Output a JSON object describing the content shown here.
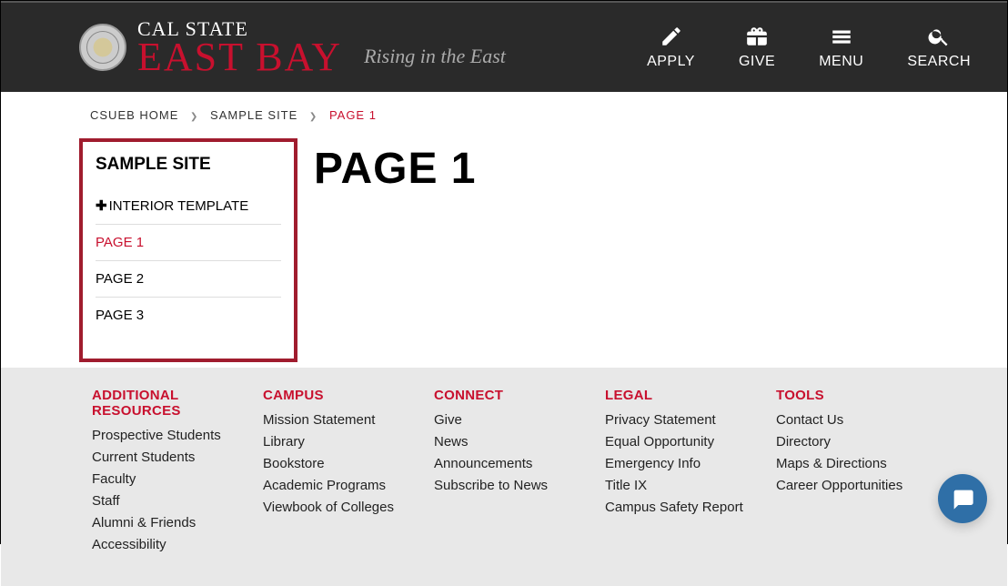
{
  "brand": {
    "top": "CAL STATE",
    "main": "EAST BAY",
    "tagline": "Rising in the East"
  },
  "headerNav": {
    "apply": "APPLY",
    "give": "GIVE",
    "menu": "MENU",
    "search": "SEARCH"
  },
  "breadcrumb": {
    "home": "CSUEB HOME",
    "site": "SAMPLE SITE",
    "current": "PAGE 1"
  },
  "sidebar": {
    "title": "SAMPLE SITE",
    "items": [
      {
        "label": "INTERIOR TEMPLATE",
        "expandable": true
      },
      {
        "label": "PAGE 1",
        "active": true
      },
      {
        "label": "PAGE 2"
      },
      {
        "label": "PAGE 3"
      }
    ]
  },
  "page": {
    "title": "PAGE 1"
  },
  "footer": {
    "cols": [
      {
        "title": "ADDITIONAL RESOURCES",
        "links": [
          "Prospective Students",
          "Current Students",
          "Faculty",
          "Staff",
          "Alumni & Friends",
          "Accessibility"
        ]
      },
      {
        "title": "CAMPUS",
        "links": [
          "Mission Statement",
          "Library",
          "Bookstore",
          "Academic Programs",
          "Viewbook of Colleges"
        ]
      },
      {
        "title": "CONNECT",
        "links": [
          "Give",
          "News",
          "Announcements",
          "Subscribe to News"
        ]
      },
      {
        "title": "LEGAL",
        "links": [
          "Privacy Statement",
          "Equal Opportunity",
          "Emergency Info",
          "Title IX",
          "Campus Safety Report"
        ]
      },
      {
        "title": "TOOLS",
        "links": [
          "Contact Us",
          "Directory",
          "Maps & Directions",
          "Career Opportunities"
        ]
      }
    ]
  },
  "colors": {
    "brandRed": "#c8102e",
    "headerBg": "#2a2a2a",
    "footerBg": "#e8e8e8",
    "highlightBorder": "#a01c2e"
  }
}
